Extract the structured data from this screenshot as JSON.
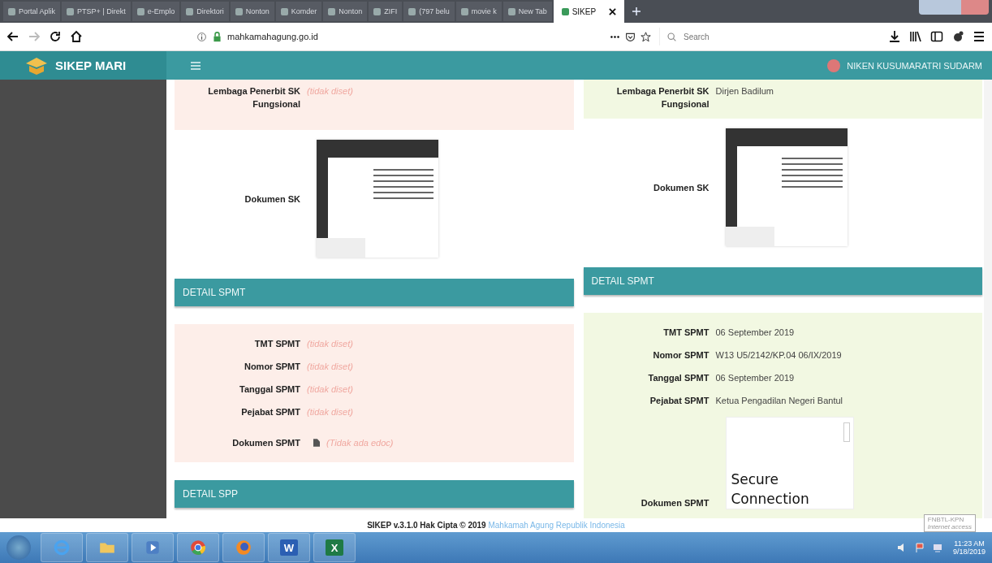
{
  "browser": {
    "tabs": [
      {
        "label": "Portal Aplik",
        "selected": false
      },
      {
        "label": "PTSP+ | Direkt",
        "selected": false
      },
      {
        "label": "e-Emplo",
        "selected": false
      },
      {
        "label": "Direktori",
        "selected": false
      },
      {
        "label": "Nonton",
        "selected": false
      },
      {
        "label": "Komder",
        "selected": false
      },
      {
        "label": "Nonton",
        "selected": false
      },
      {
        "label": "ZIFI",
        "selected": false
      },
      {
        "label": "(797 belu",
        "selected": false
      },
      {
        "label": "movie k",
        "selected": false
      },
      {
        "label": "New Tab",
        "selected": false
      },
      {
        "label": "SIKEP",
        "selected": true
      }
    ],
    "url": {
      "host": "mahkamahagung.go.id"
    },
    "search": {
      "placeholder": "Search"
    }
  },
  "app": {
    "title": "SIKEP MARI",
    "user": "NIKEN KUSUMARATRI SUDARM"
  },
  "columns": [
    {
      "color": "#fdeee9",
      "sk": {
        "label": "Lembaga Penerbit SK Fungsional",
        "value": "(tidak diset)",
        "unset": true
      },
      "doc_label": "Dokumen SK",
      "spmt_title": "DETAIL SPMT",
      "spmt_rows": [
        {
          "label": "TMT SPMT",
          "value": "(tidak diset)",
          "unset": true
        },
        {
          "label": "Nomor SPMT",
          "value": "(tidak diset)",
          "unset": true
        },
        {
          "label": "Tanggal SPMT",
          "value": "(tidak diset)",
          "unset": true
        },
        {
          "label": "Pejabat SPMT",
          "value": "(tidak diset)",
          "unset": true
        }
      ],
      "doc_spmt": {
        "label": "Dokumen SPMT",
        "kind": "none",
        "text": "(Tidak ada edoc)"
      },
      "next_title": "DETAIL SPP"
    },
    {
      "color": "#f2f8e2",
      "sk": {
        "label": "Lembaga Penerbit SK Fungsional",
        "value": "Dirjen Badilum",
        "unset": false
      },
      "doc_label": "Dokumen SK",
      "spmt_title": "DETAIL SPMT",
      "spmt_rows": [
        {
          "label": "TMT SPMT",
          "value": "06 September 2019",
          "unset": false
        },
        {
          "label": "Nomor SPMT",
          "value": "W13 U5/2142/KP.04 06/IX/2019",
          "unset": false
        },
        {
          "label": "Tanggal SPMT",
          "value": "06 September 2019",
          "unset": false
        },
        {
          "label": "Pejabat SPMT",
          "value": "Ketua Pengadilan Negeri Bantul",
          "unset": false
        }
      ],
      "doc_spmt": {
        "label": "Dokumen SPMT",
        "kind": "viewer",
        "text": "Secure Connection"
      }
    }
  ],
  "footer": {
    "text": "SIKEP v.3.1.0 Hak Cipta © 2019",
    "link": "Mahkamah Agung Republik Indonesia"
  },
  "tooltip": {
    "title": "FNBTL-KPN",
    "text": "Internet access"
  },
  "taskbar": {
    "apps": [
      {
        "kind": "ie"
      },
      {
        "kind": "folder"
      },
      {
        "kind": "media"
      },
      {
        "kind": "chrome"
      },
      {
        "kind": "firefox"
      },
      {
        "kind": "word",
        "letter": "W"
      },
      {
        "kind": "excel",
        "letter": "X"
      }
    ],
    "time": "11:23 AM",
    "date": "9/18/2019"
  }
}
